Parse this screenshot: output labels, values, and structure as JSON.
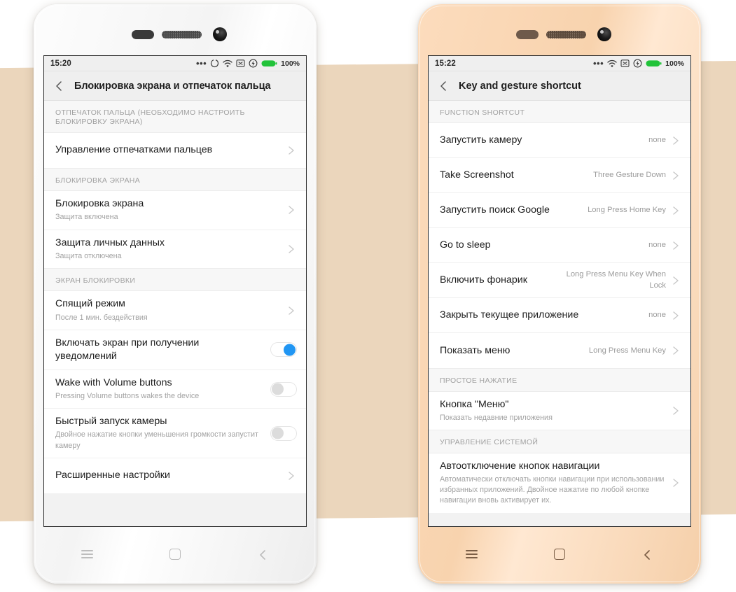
{
  "background": {
    "page_color": "#ffffff",
    "band_color": "#ebd6bc"
  },
  "phones": [
    {
      "id": "left-phone",
      "body_color": "#f4f4f4",
      "status_bar": {
        "time": "15:20",
        "dots": "•••",
        "icons": [
          "alarm-circle-icon",
          "wifi-icon",
          "no-sim-icon",
          "flash-icon",
          "battery-icon"
        ],
        "battery_percent": "100%",
        "battery_color": "#22c33a"
      },
      "app_bar": {
        "back_icon": "back-chevron-icon",
        "title": "Блокировка экрана и отпечаток пальца",
        "lang": "ru"
      },
      "sections": [
        {
          "header": "ОТПЕЧАТОК ПАЛЬЦА (НЕОБХОДИМО НАСТРОИТЬ БЛОКИРОВКУ ЭКРАНА)",
          "rows": [
            {
              "title": "Управление отпечатками пальцев",
              "sub": "",
              "value": "",
              "control": "chevron"
            }
          ]
        },
        {
          "header": "БЛОКИРОВКА ЭКРАНА",
          "rows": [
            {
              "title": "Блокировка экрана",
              "sub": "Защита включена",
              "value": "",
              "control": "chevron"
            },
            {
              "title": "Защита личных данных",
              "sub": "Защита отключена",
              "value": "",
              "control": "chevron"
            }
          ]
        },
        {
          "header": "ЭКРАН БЛОКИРОВКИ",
          "rows": [
            {
              "title": "Спящий режим",
              "sub": "После 1 мин. бездействия",
              "value": "",
              "control": "chevron"
            },
            {
              "title": "Включать экран при получении уведомлений",
              "sub": "",
              "value": "",
              "control": "toggle-on"
            },
            {
              "title": "Wake with Volume buttons",
              "sub": "Pressing Volume buttons wakes the device",
              "value": "",
              "control": "toggle-off"
            },
            {
              "title": "Быстрый запуск камеры",
              "sub": "Двойное нажатие кнопки уменьшения громкости запустит камеру",
              "value": "",
              "control": "toggle-off"
            },
            {
              "title": "Расширенные настройки",
              "sub": "",
              "value": "",
              "control": "chevron"
            }
          ]
        }
      ],
      "nav_bar": {
        "menu_icon": "menu-hamburger-icon",
        "home_icon": "home-square-icon",
        "back_icon": "back-chevron-icon",
        "icon_color": "#bdbdbd"
      }
    },
    {
      "id": "right-phone",
      "body_color": "#f8d3ae",
      "status_bar": {
        "time": "15:22",
        "dots": "•••",
        "icons": [
          "wifi-icon",
          "no-sim-icon",
          "flash-icon",
          "battery-icon"
        ],
        "battery_percent": "100%",
        "battery_color": "#22c33a"
      },
      "app_bar": {
        "back_icon": "back-chevron-icon",
        "title": "Key and gesture shortcut",
        "lang": "en"
      },
      "sections": [
        {
          "header": "FUNCTION SHORTCUT",
          "rows": [
            {
              "title": "Запустить камеру",
              "sub": "",
              "value": "none",
              "control": "chevron"
            },
            {
              "title": "Take Screenshot",
              "sub": "",
              "value": "Three Gesture Down",
              "control": "chevron"
            },
            {
              "title": "Запустить поиск Google",
              "sub": "",
              "value": "Long Press Home Key",
              "control": "chevron"
            },
            {
              "title": "Go to sleep",
              "sub": "",
              "value": "none",
              "control": "chevron"
            },
            {
              "title": "Включить фонарик",
              "sub": "",
              "value": "Long Press Menu Key When Lock",
              "control": "chevron"
            },
            {
              "title": "Закрыть текущее приложение",
              "sub": "",
              "value": "none",
              "control": "chevron"
            },
            {
              "title": "Показать меню",
              "sub": "",
              "value": "Long Press Menu Key",
              "control": "chevron"
            }
          ]
        },
        {
          "header": "ПРОСТОЕ НАЖАТИЕ",
          "rows": [
            {
              "title": "Кнопка \"Меню\"",
              "sub": "Показать недавние приложения",
              "value": "",
              "control": "chevron"
            }
          ]
        },
        {
          "header": "УПРАВЛЕНИЕ СИСТЕМОЙ",
          "rows": [
            {
              "title": "Автоотключение кнопок навигации",
              "sub": "Автоматически отключать кнопки навигации при использовании избранных приложений. Двойное нажатие по любой кнопке навигации вновь активирует их.",
              "value": "",
              "control": "chevron"
            }
          ]
        }
      ],
      "nav_bar": {
        "menu_icon": "menu-hamburger-icon",
        "home_icon": "home-square-icon",
        "back_icon": "back-chevron-icon",
        "icon_color": "#7b5e46"
      }
    }
  ]
}
